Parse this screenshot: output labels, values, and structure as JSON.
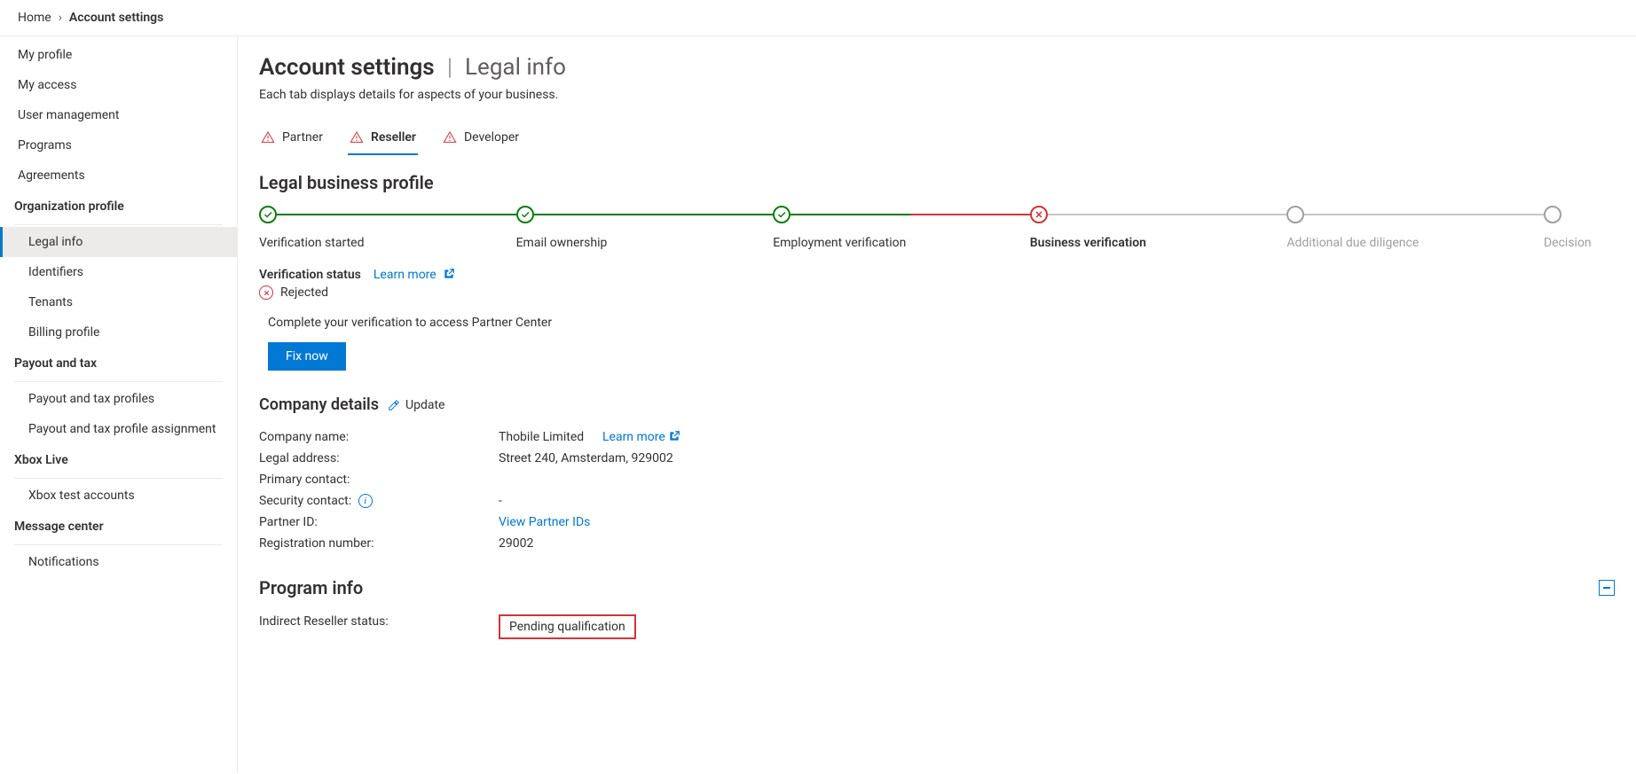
{
  "breadcrumb": {
    "home": "Home",
    "current": "Account settings"
  },
  "sidebar": {
    "top": [
      {
        "label": "My profile"
      },
      {
        "label": "My access"
      },
      {
        "label": "User management"
      },
      {
        "label": "Programs"
      },
      {
        "label": "Agreements"
      }
    ],
    "groups": [
      {
        "header": "Organization profile",
        "items": [
          {
            "label": "Legal info",
            "active": true
          },
          {
            "label": "Identifiers"
          },
          {
            "label": "Tenants"
          },
          {
            "label": "Billing profile"
          }
        ]
      },
      {
        "header": "Payout and tax",
        "items": [
          {
            "label": "Payout and tax profiles"
          },
          {
            "label": "Payout and tax profile assignment"
          }
        ]
      },
      {
        "header": "Xbox Live",
        "items": [
          {
            "label": "Xbox test accounts"
          }
        ]
      },
      {
        "header": "Message center",
        "items": [
          {
            "label": "Notifications"
          }
        ]
      }
    ]
  },
  "page": {
    "title": "Account settings",
    "subtitle": "Legal info",
    "description": "Each tab displays details for aspects of your business."
  },
  "tabs": [
    {
      "label": "Partner",
      "warn": true
    },
    {
      "label": "Reseller",
      "warn": true,
      "active": true
    },
    {
      "label": "Developer",
      "warn": true
    }
  ],
  "profile": {
    "heading": "Legal business profile",
    "steps": [
      {
        "label": "Verification started",
        "state": "done",
        "connector": "green"
      },
      {
        "label": "Email ownership",
        "state": "done",
        "connector": "green"
      },
      {
        "label": "Employment verification",
        "state": "done",
        "connector": "red"
      },
      {
        "label": "Business verification",
        "state": "err",
        "bold": true,
        "connector": "grey"
      },
      {
        "label": "Additional due diligence",
        "state": "pend",
        "faded": true,
        "connector": "grey"
      },
      {
        "label": "Decision",
        "state": "pend",
        "faded": true
      }
    ],
    "verification_status_label": "Verification status",
    "learn_more": "Learn more",
    "rejected_label": "Rejected",
    "fix_text": "Complete your verification to access Partner Center",
    "fix_button": "Fix now"
  },
  "company": {
    "heading": "Company details",
    "update": "Update",
    "fields": {
      "company_name_label": "Company name:",
      "company_name_value": "Thobile Limited",
      "learn_more": "Learn more",
      "legal_address_label": "Legal address:",
      "legal_address_value": "Street 240, Amsterdam, 929002",
      "primary_contact_label": "Primary contact:",
      "primary_contact_value": "",
      "security_contact_label": "Security contact:",
      "security_contact_value": "-",
      "partner_id_label": "Partner ID:",
      "partner_id_link": "View Partner IDs",
      "registration_number_label": "Registration number:",
      "registration_number_value": "29002"
    }
  },
  "program": {
    "heading": "Program info",
    "status_label": "Indirect Reseller status:",
    "status_value": "Pending qualification"
  }
}
